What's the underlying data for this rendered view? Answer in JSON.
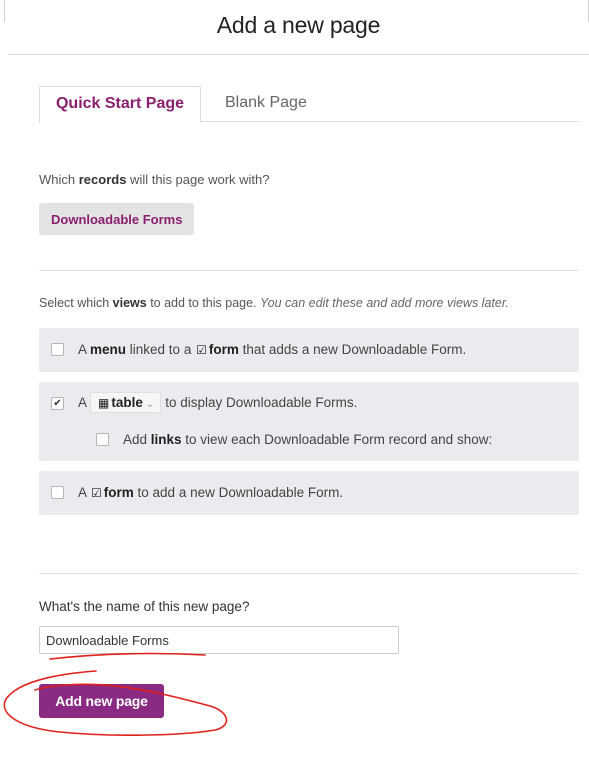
{
  "title": "Add a new page",
  "tabs": [
    {
      "label": "Quick Start Page",
      "active": true
    },
    {
      "label": "Blank Page",
      "active": false
    }
  ],
  "records": {
    "question_prefix": "Which ",
    "question_bold": "records",
    "question_suffix": " will this page work with?",
    "selected": "Downloadable Forms"
  },
  "views": {
    "prefix": "Select which ",
    "bold": "views",
    "suffix": " to add to this page. ",
    "hint": "You can edit these and add more views later.",
    "options": [
      {
        "checked": false,
        "t1": "A ",
        "b1": "menu",
        "t2": " linked to a ",
        "icon": "form-check-icon",
        "b2": "form",
        "t3": " that adds a new Downloadable Form."
      },
      {
        "checked": true,
        "t1": "A",
        "select": "table",
        "t2": "to display Downloadable Forms.",
        "sub": {
          "checked": false,
          "t1": "Add ",
          "b1": "links",
          "t2": " to view each Downloadable Form record and show:"
        }
      },
      {
        "checked": false,
        "t1": "A ",
        "icon": "form-check-icon",
        "b1": "form",
        "t2": " to add a new Downloadable Form."
      }
    ]
  },
  "name": {
    "label": "What's the name of this new page?",
    "value": "Downloadable Forms"
  },
  "submit_label": "Add new page",
  "annotation_color": "#e0201b",
  "accent_color": "#8a2a82"
}
